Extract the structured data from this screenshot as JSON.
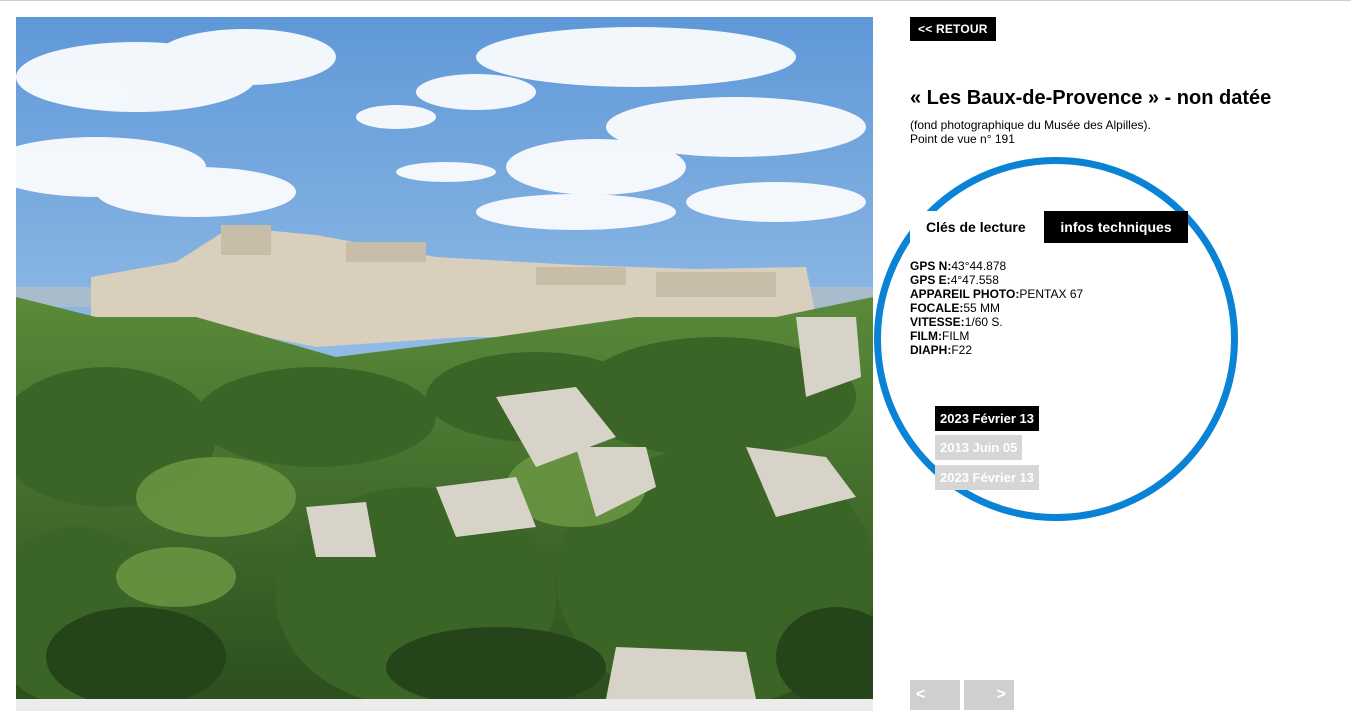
{
  "header": {
    "back_label": "<< RETOUR"
  },
  "photo": {
    "subject": "Les Baux-de-Provence landscape photograph",
    "sky_color": "#7fb0e0",
    "vegetation_color": "#3f6b2a",
    "rock_color": "#d8d2c4"
  },
  "info": {
    "title": "« Les Baux-de-Provence » - non datée",
    "caption_line1": "(fond photographique du Musée des Alpilles).",
    "caption_line2": "Point de vue n° 191"
  },
  "tabs": [
    {
      "label": "Clés de lecture",
      "active": false
    },
    {
      "label": "infos techniques",
      "active": true
    }
  ],
  "specs": [
    {
      "key": "GPS N:",
      "value": "43°44.878"
    },
    {
      "key": "GPS E:",
      "value": "4°47.558"
    },
    {
      "key": "APPAREIL PHOTO:",
      "value": "PENTAX 67"
    },
    {
      "key": "FOCALE:",
      "value": "55 MM"
    },
    {
      "key": "VITESSE:",
      "value": "1/60 S."
    },
    {
      "key": "FILM:",
      "value": "FILM"
    },
    {
      "key": "DIAPH:",
      "value": "F22"
    }
  ],
  "dates": [
    {
      "label": "2023 Février 13",
      "selected": true
    },
    {
      "label": "2013 Juin 05",
      "selected": false
    },
    {
      "label": "2023 Février 13",
      "selected": false
    }
  ],
  "navigation": {
    "prev_label": "<",
    "next_label": ">"
  },
  "colors": {
    "accent_circle": "#0a82d6",
    "button_dark": "#000000",
    "button_light": "#d6d6d6"
  }
}
